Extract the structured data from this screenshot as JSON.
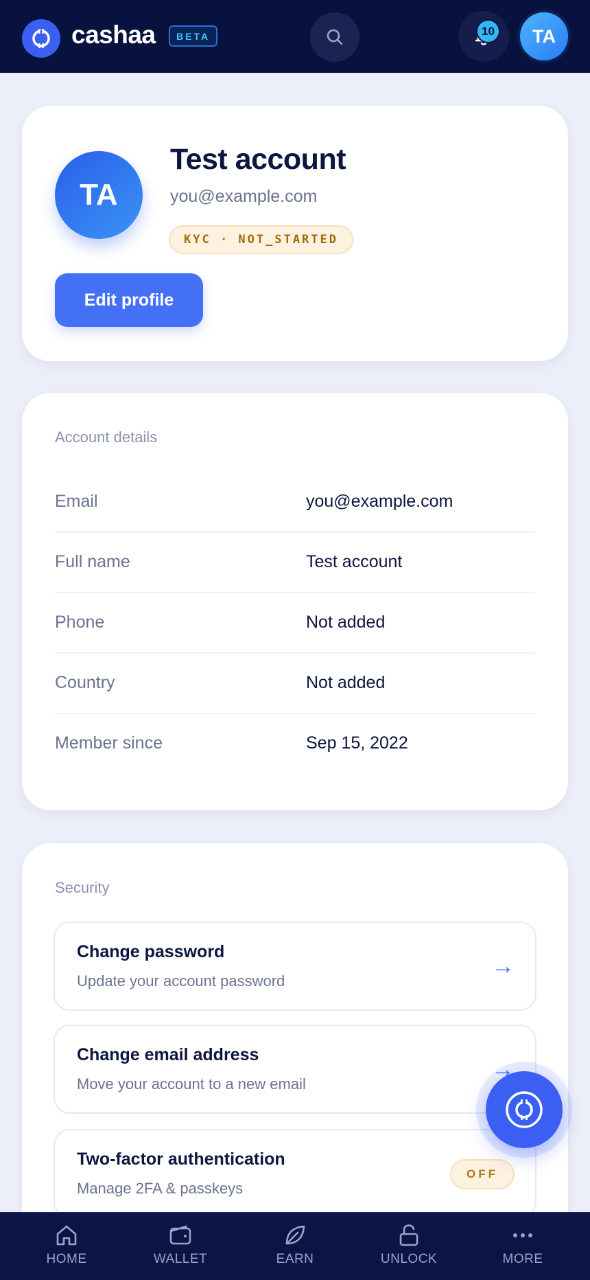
{
  "header": {
    "brand_name": "cashaa",
    "beta_label": "BETA",
    "notification_count": "10",
    "avatar_initials": "TA"
  },
  "profile": {
    "initials": "TA",
    "name": "Test account",
    "email": "you@example.com",
    "kyc_status": "KYC · NOT_STARTED",
    "edit_button": "Edit profile"
  },
  "account_details": {
    "title": "Account details",
    "rows": [
      {
        "label": "Email",
        "value": "you@example.com"
      },
      {
        "label": "Full name",
        "value": "Test account"
      },
      {
        "label": "Phone",
        "value": "Not added"
      },
      {
        "label": "Country",
        "value": "Not added"
      },
      {
        "label": "Member since",
        "value": "Sep 15, 2022"
      }
    ]
  },
  "security": {
    "title": "Security",
    "items": [
      {
        "title": "Change password",
        "subtitle": "Update your account password",
        "action": "→"
      },
      {
        "title": "Change email address",
        "subtitle": "Move your account to a new email",
        "action": "→"
      },
      {
        "title": "Two-factor authentication",
        "subtitle": "Manage 2FA & passkeys",
        "status": "OFF"
      }
    ]
  },
  "bottom_nav": {
    "items": [
      {
        "label": "HOME",
        "icon": "home-icon"
      },
      {
        "label": "WALLET",
        "icon": "wallet-icon"
      },
      {
        "label": "EARN",
        "icon": "leaf-icon"
      },
      {
        "label": "UNLOCK",
        "icon": "unlock-icon"
      },
      {
        "label": "MORE",
        "icon": "more-icon"
      }
    ]
  },
  "colors": {
    "topbar": "#08123f",
    "accent": "#4470f5",
    "kyc_badge_bg": "#fdf1e0",
    "kyc_badge_text": "#a56a0a"
  }
}
